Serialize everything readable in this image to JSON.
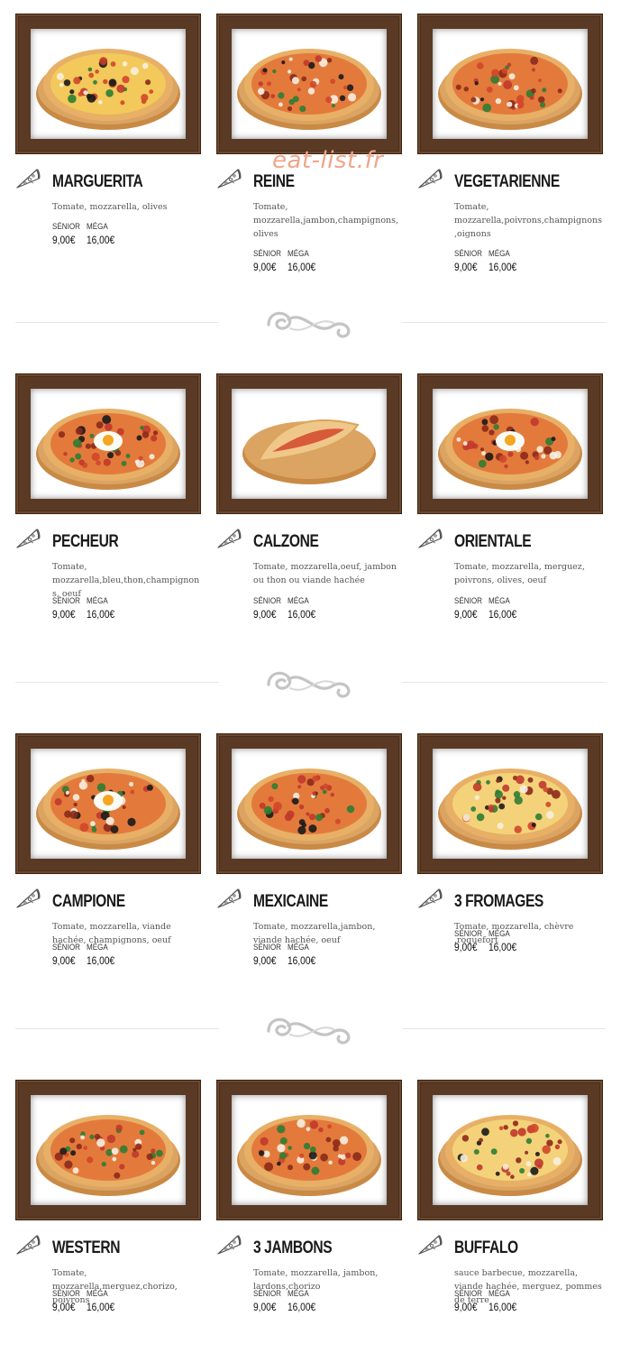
{
  "watermark": "eat-list.fr",
  "size_labels": {
    "senior": "SÉNIOR",
    "mega": "MÉGA"
  },
  "pizzas": [
    {
      "name": "MARGUERITA",
      "desc": "Tomate, mozzarella, olives",
      "senior": "9,00€",
      "mega": "16,00€"
    },
    {
      "name": "REINE",
      "desc": "Tomate, mozzarella,jambon,champignons, olives",
      "senior": "9,00€",
      "mega": "16,00€"
    },
    {
      "name": "VEGETARIENNE",
      "desc": "Tomate, mozzarella,poivrons,champignons,oignons",
      "senior": "9,00€",
      "mega": "16,00€"
    },
    {
      "name": "PECHEUR",
      "desc": "Tomate, mozzarella,bleu,thon,champignons, oeuf",
      "senior": "9,00€",
      "mega": "16,00€"
    },
    {
      "name": "CALZONE",
      "desc": "Tomate, mozzarella,oeuf, jambon ou thon ou viande hachée",
      "senior": "9,00€",
      "mega": "16,00€"
    },
    {
      "name": "ORIENTALE",
      "desc": "Tomate, mozzarella, merguez, poivrons, olives, oeuf",
      "senior": "9,00€",
      "mega": "16,00€"
    },
    {
      "name": "CAMPIONE",
      "desc": "Tomate, mozzarella, viande hachée, champignons, oeuf",
      "senior": "9,00€",
      "mega": "16,00€"
    },
    {
      "name": "MEXICAINE",
      "desc": "Tomate, mozzarella,jambon, viande hachée, oeuf",
      "senior": "9,00€",
      "mega": "16,00€"
    },
    {
      "name": "3 FROMAGES",
      "desc": "Tomate, mozzarella, chèvre ,roquefort",
      "senior": "9,00€",
      "mega": "16,00€"
    },
    {
      "name": "WESTERN",
      "desc": "Tomate, mozzarella,merguez,chorizo, poivrons",
      "senior": "9,00€",
      "mega": "16,00€"
    },
    {
      "name": "3 JAMBONS",
      "desc": "Tomate, mozzarella, jambon, lardons,chorizo",
      "senior": "9,00€",
      "mega": "16,00€"
    },
    {
      "name": "BUFFALO",
      "desc": "sauce barbecue, mozzarella, viande hachée, merguez, pommes de terre",
      "senior": "9,00€",
      "mega": "16,00€"
    }
  ],
  "icons": {
    "slice": "pizza-slice-icon",
    "divider": "swirl-ornament-icon"
  },
  "colors": {
    "frame": "#5a3a24",
    "watermark": "#f0a58a",
    "crust": "#e7b066",
    "sauce": "#d2462a",
    "cheese": "#f4d27a"
  }
}
